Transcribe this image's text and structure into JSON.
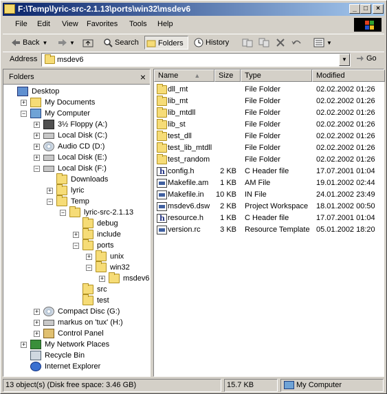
{
  "window": {
    "title": "F:\\Temp\\lyric-src-2.1.13\\ports\\win32\\msdev6",
    "min_glyph": "_",
    "max_glyph": "□",
    "close_glyph": "×"
  },
  "menu": [
    "File",
    "Edit",
    "View",
    "Favorites",
    "Tools",
    "Help"
  ],
  "toolbar": {
    "back": "Back",
    "search": "Search",
    "folders": "Folders",
    "history": "History"
  },
  "address": {
    "label": "Address",
    "value": "msdev6",
    "go": "Go"
  },
  "folders_pane": {
    "title": "Folders",
    "close": "×",
    "tree": [
      {
        "label": "Desktop",
        "icon": "desktop",
        "exp": ""
      },
      {
        "label": "My Documents",
        "icon": "my-documents",
        "exp": "+"
      },
      {
        "label": "My Computer",
        "icon": "my-computer",
        "exp": "−"
      },
      {
        "label": "3½ Floppy (A:)",
        "icon": "floppy",
        "exp": "+"
      },
      {
        "label": "Local Disk (C:)",
        "icon": "drive",
        "exp": "+"
      },
      {
        "label": "Audio CD (D:)",
        "icon": "cd",
        "exp": "+"
      },
      {
        "label": "Local Disk (E:)",
        "icon": "drive",
        "exp": "+"
      },
      {
        "label": "Local Disk (F:)",
        "icon": "drive",
        "exp": "−"
      },
      {
        "label": "Downloads",
        "icon": "folder",
        "exp": ""
      },
      {
        "label": "lyric",
        "icon": "folder",
        "exp": "+"
      },
      {
        "label": "Temp",
        "icon": "folder",
        "exp": "−"
      },
      {
        "label": "lyric-src-2.1.13",
        "icon": "folder",
        "exp": "−"
      },
      {
        "label": "debug",
        "icon": "folder",
        "exp": ""
      },
      {
        "label": "include",
        "icon": "folder",
        "exp": "+"
      },
      {
        "label": "ports",
        "icon": "folder",
        "exp": "−"
      },
      {
        "label": "unix",
        "icon": "folder",
        "exp": "+"
      },
      {
        "label": "win32",
        "icon": "folder",
        "exp": "−"
      },
      {
        "label": "msdev6",
        "icon": "folder",
        "exp": "+"
      },
      {
        "label": "src",
        "icon": "folder",
        "exp": ""
      },
      {
        "label": "test",
        "icon": "folder",
        "exp": ""
      },
      {
        "label": "Compact Disc (G:)",
        "icon": "cd",
        "exp": "+"
      },
      {
        "label": "markus on 'tux' (H:)",
        "icon": "network-drive",
        "exp": "+"
      },
      {
        "label": "Control Panel",
        "icon": "control-panel",
        "exp": "+"
      },
      {
        "label": "My Network Places",
        "icon": "network",
        "exp": "+"
      },
      {
        "label": "Recycle Bin",
        "icon": "recycle-bin",
        "exp": ""
      },
      {
        "label": "Internet Explorer",
        "icon": "internet-explorer",
        "exp": ""
      }
    ]
  },
  "files": {
    "columns": {
      "name": "Name",
      "size": "Size",
      "type": "Type",
      "modified": "Modified"
    },
    "rows": [
      {
        "name": "dll_mt",
        "size": "",
        "type": "File Folder",
        "modified": "02.02.2002 01:26",
        "icon": "folder"
      },
      {
        "name": "lib_mt",
        "size": "",
        "type": "File Folder",
        "modified": "02.02.2002 01:26",
        "icon": "folder"
      },
      {
        "name": "lib_mtdll",
        "size": "",
        "type": "File Folder",
        "modified": "02.02.2002 01:26",
        "icon": "folder"
      },
      {
        "name": "lib_st",
        "size": "",
        "type": "File Folder",
        "modified": "02.02.2002 01:26",
        "icon": "folder"
      },
      {
        "name": "test_dll",
        "size": "",
        "type": "File Folder",
        "modified": "02.02.2002 01:26",
        "icon": "folder"
      },
      {
        "name": "test_lib_mtdll",
        "size": "",
        "type": "File Folder",
        "modified": "02.02.2002 01:26",
        "icon": "folder"
      },
      {
        "name": "test_random",
        "size": "",
        "type": "File Folder",
        "modified": "02.02.2002 01:26",
        "icon": "folder"
      },
      {
        "name": "config.h",
        "size": "2 KB",
        "type": "C Header file",
        "modified": "17.07.2001 01:04",
        "icon": "h-file"
      },
      {
        "name": "Makefile.am",
        "size": "1 KB",
        "type": "AM File",
        "modified": "19.01.2002 02:44",
        "icon": "doc-file"
      },
      {
        "name": "Makefile.in",
        "size": "10 KB",
        "type": "IN File",
        "modified": "24.01.2002 23:49",
        "icon": "doc-file"
      },
      {
        "name": "msdev6.dsw",
        "size": "2 KB",
        "type": "Project Workspace",
        "modified": "18.01.2002 00:50",
        "icon": "doc-file"
      },
      {
        "name": "resource.h",
        "size": "1 KB",
        "type": "C Header file",
        "modified": "17.07.2001 01:04",
        "icon": "h-file"
      },
      {
        "name": "version.rc",
        "size": "3 KB",
        "type": "Resource Template",
        "modified": "05.01.2002 18:20",
        "icon": "doc-file"
      }
    ]
  },
  "status": {
    "objects": "13 object(s) (Disk free space: 3.46 GB)",
    "size": "15.7 KB",
    "zone": "My Computer"
  }
}
